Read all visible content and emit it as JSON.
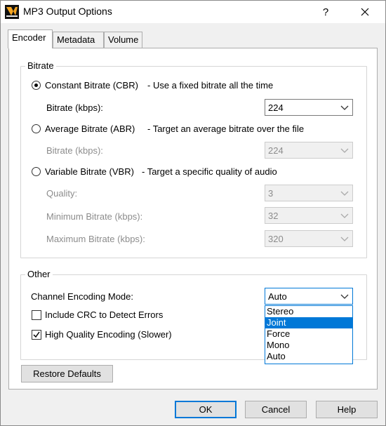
{
  "window": {
    "title": "MP3 Output Options",
    "help_label": "?",
    "close_label": "✕"
  },
  "tabs": [
    {
      "label": "Encoder",
      "active": true
    },
    {
      "label": "Metadata",
      "active": false
    },
    {
      "label": "Volume",
      "active": false
    }
  ],
  "bitrate_group": {
    "title": "Bitrate",
    "cbr": {
      "label": "Constant Bitrate (CBR)",
      "description": "-  Use a fixed bitrate all the time",
      "selected": true,
      "bitrate_label": "Bitrate (kbps):",
      "bitrate_value": "224"
    },
    "abr": {
      "label": "Average Bitrate (ABR)",
      "description": "-  Target an average bitrate over the file",
      "selected": false,
      "bitrate_label": "Bitrate (kbps):",
      "bitrate_value": "224"
    },
    "vbr": {
      "label": "Variable Bitrate (VBR)",
      "description": "-  Target a specific quality of audio",
      "selected": false,
      "quality_label": "Quality:",
      "quality_value": "3",
      "min_label": "Minimum Bitrate (kbps):",
      "min_value": "32",
      "max_label": "Maximum Bitrate (kbps):",
      "max_value": "320"
    }
  },
  "other_group": {
    "title": "Other",
    "channel_label": "Channel Encoding Mode:",
    "channel_value": "Auto",
    "channel_options": [
      "Stereo",
      "Joint",
      "Force",
      "Mono",
      "Auto"
    ],
    "highlighted_option": "Joint",
    "crc_label": "Include CRC to Detect Errors",
    "crc_checked": false,
    "hq_label": "High Quality Encoding (Slower)",
    "hq_checked": true
  },
  "buttons": {
    "restore": "Restore Defaults",
    "ok": "OK",
    "cancel": "Cancel",
    "help": "Help"
  },
  "colors": {
    "accent": "#0078d7",
    "disabled_text": "#8c8c8c"
  }
}
